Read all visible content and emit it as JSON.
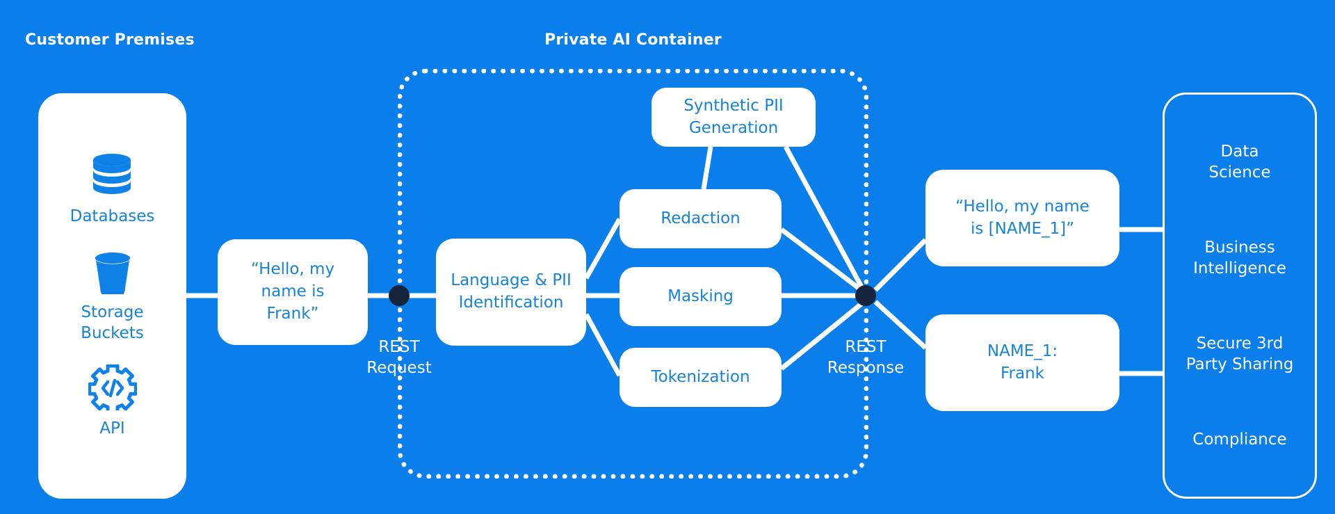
{
  "sections": {
    "customer_premises_title": "Customer Premises",
    "private_ai_container_title": "Private AI Container"
  },
  "customer_premises": {
    "items": [
      {
        "label": "Databases",
        "icon": "database-icon"
      },
      {
        "label": "Storage\nBuckets",
        "icon": "storage-bucket-icon"
      },
      {
        "label": "API",
        "icon": "api-gear-icon"
      }
    ]
  },
  "pipeline": {
    "input_message": "“Hello, my\nname is\nFrank”",
    "rest_request_label": "REST\nRequest",
    "language_pii": "Language & PII\nIdentification",
    "transforms": [
      {
        "label": "Synthetic PII\nGeneration"
      },
      {
        "label": "Redaction"
      },
      {
        "label": "Masking"
      },
      {
        "label": "Tokenization"
      }
    ],
    "rest_response_label": "REST\nResponse"
  },
  "outputs": [
    {
      "label": "“Hello, my name\nis [NAME_1]”"
    },
    {
      "label": "NAME_1:\nFrank"
    }
  ],
  "outcomes": [
    {
      "label": "Data\nScience"
    },
    {
      "label": "Business\nIntelligence"
    },
    {
      "label": "Secure 3rd\nParty Sharing"
    },
    {
      "label": "Compliance"
    }
  ],
  "colors": {
    "background": "#0a7fec",
    "card_background": "#ffffff",
    "card_text": "#1683d8",
    "hub_dot": "#14253d",
    "white_text": "#ffffff"
  }
}
